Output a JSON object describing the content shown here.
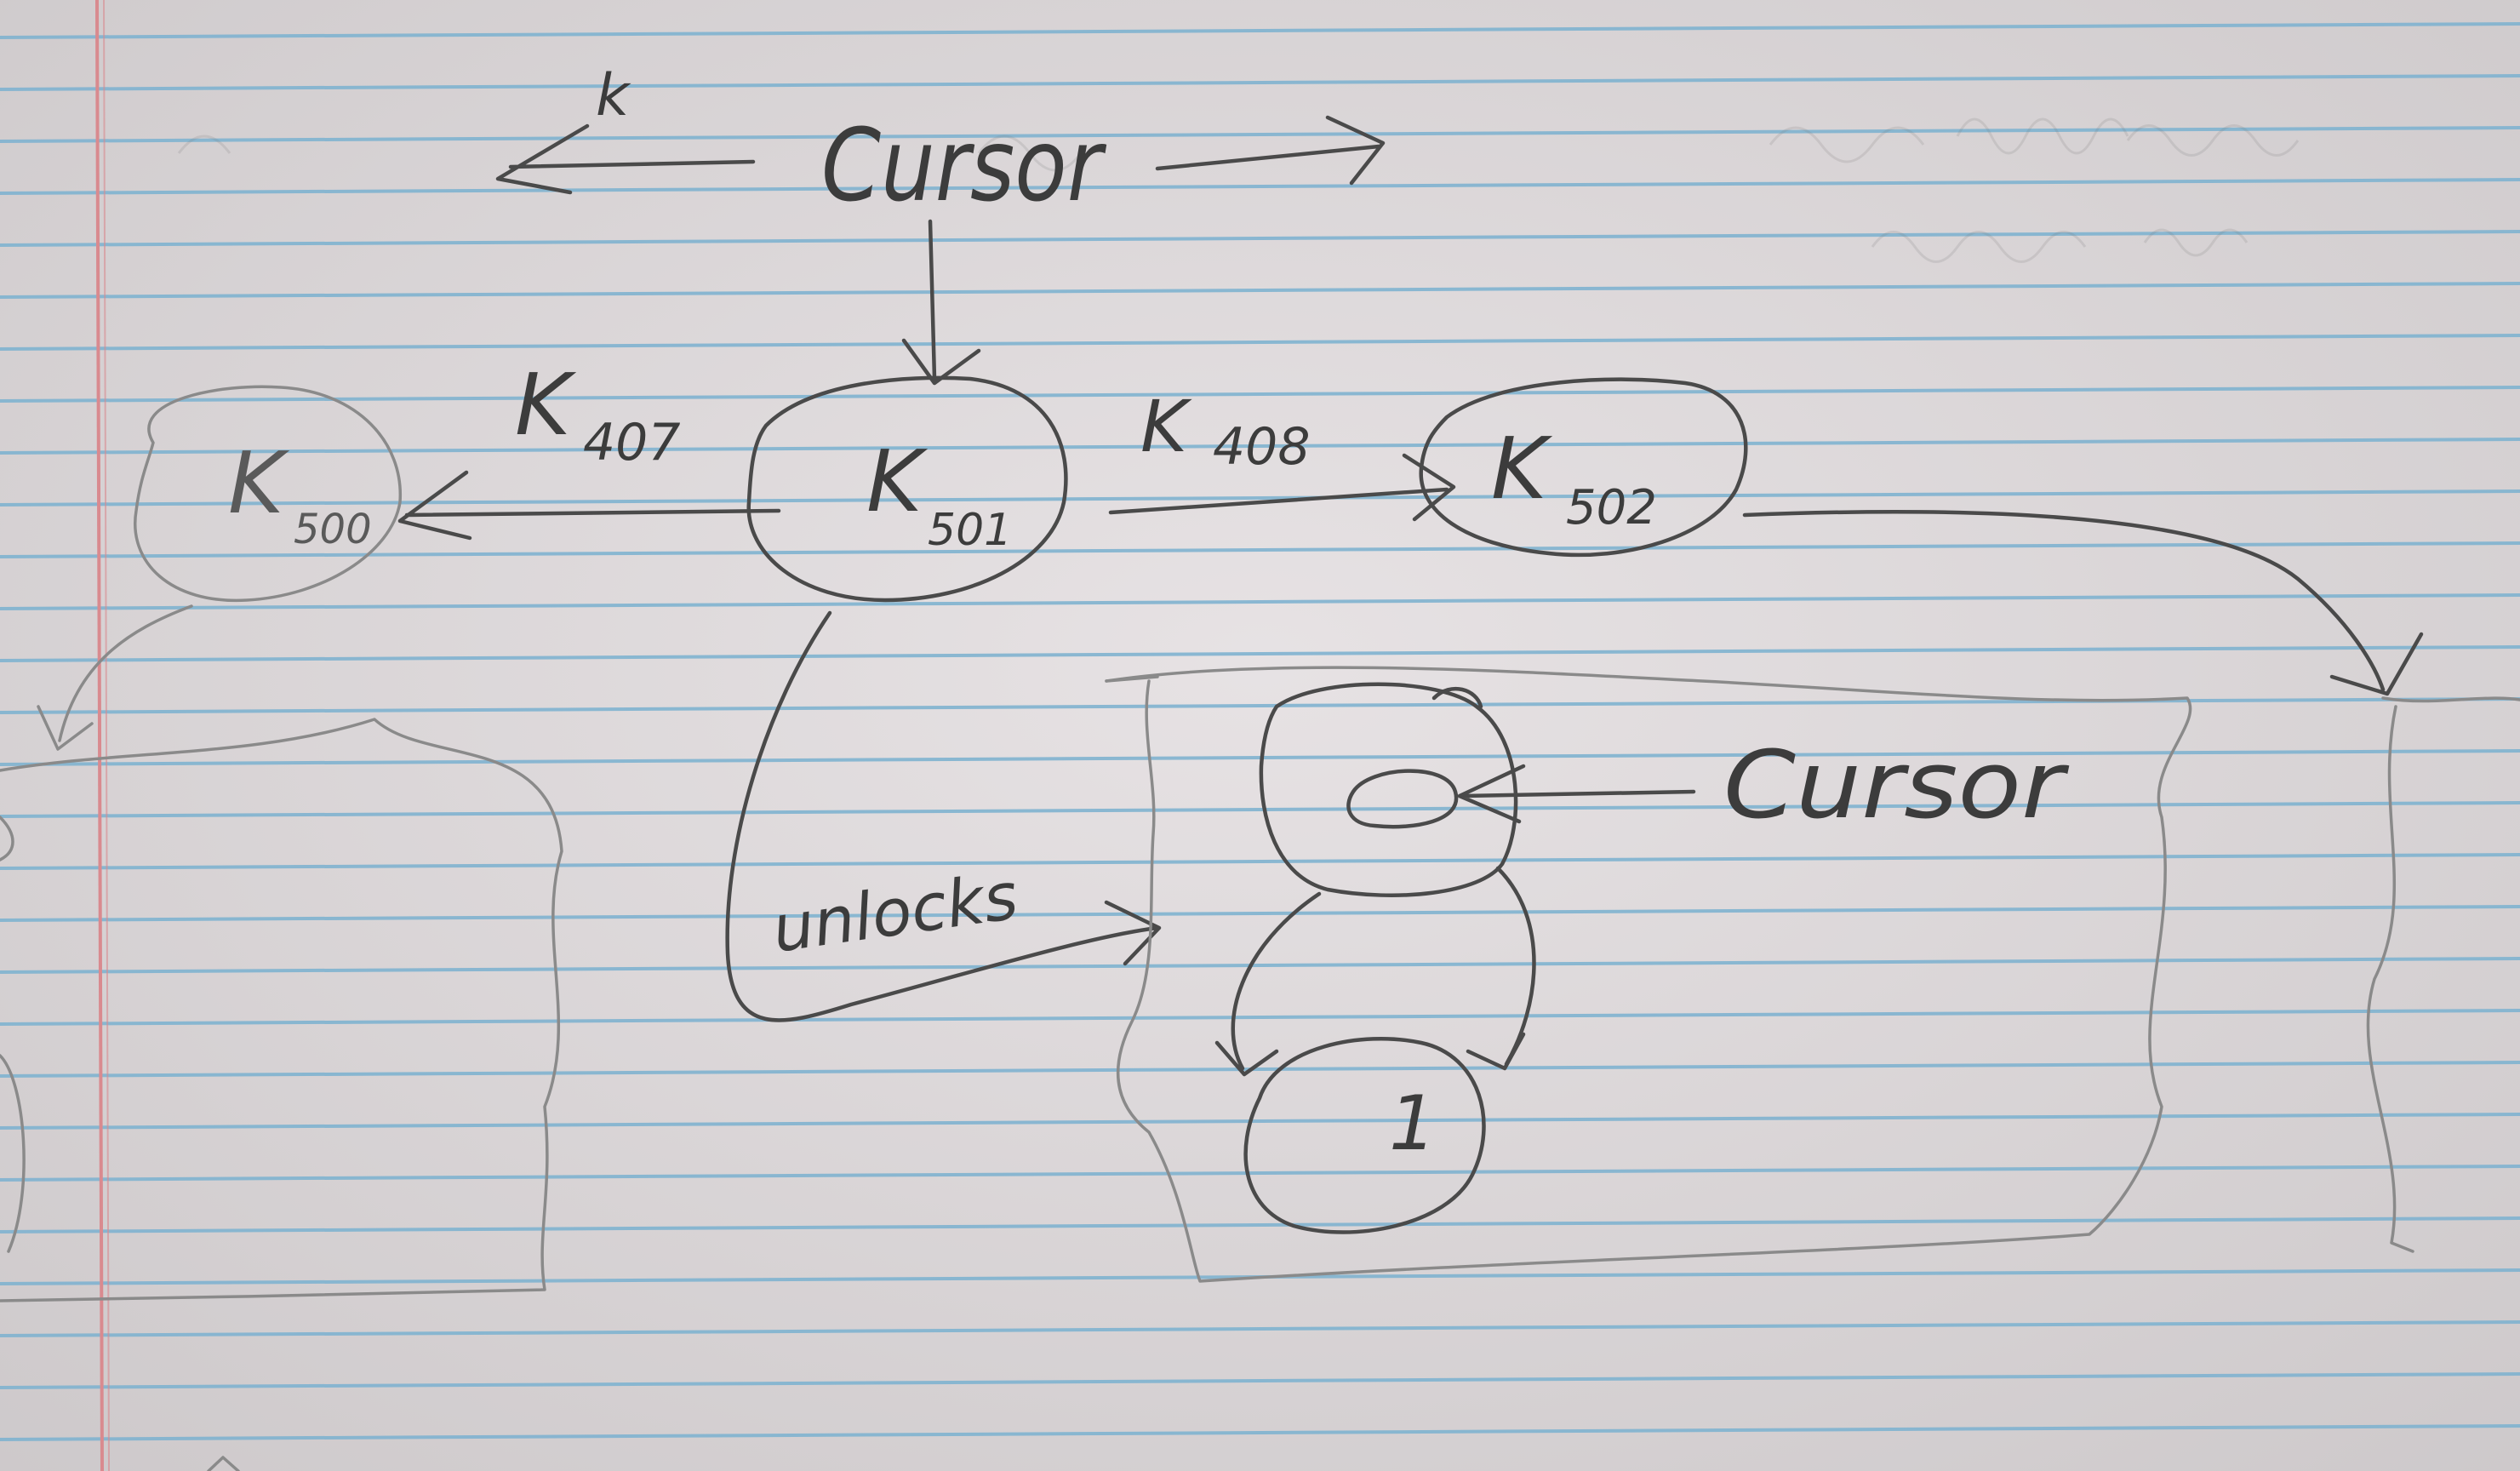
{
  "labels": {
    "top_cursor": "Cursor",
    "top_left_arrow_mark": "k",
    "node_left_main": "K",
    "node_left_sub": "500",
    "node_center_main": "K",
    "node_center_sub": "501",
    "node_right_main": "K",
    "node_right_sub": "502",
    "edge_left_main": "K",
    "edge_left_sub": "407",
    "edge_right_main": "K",
    "edge_right_sub": "408",
    "unlocks": "unlocks",
    "inner_cursor": "Cursor",
    "inner_node_bottom": "1"
  },
  "colors": {
    "paper": "#e4dfe1",
    "rule_line": "#7fb3cf",
    "margin_line": "#d98a8f",
    "ink": "#4a4a4a",
    "ink_light": "#8a8a8a"
  }
}
